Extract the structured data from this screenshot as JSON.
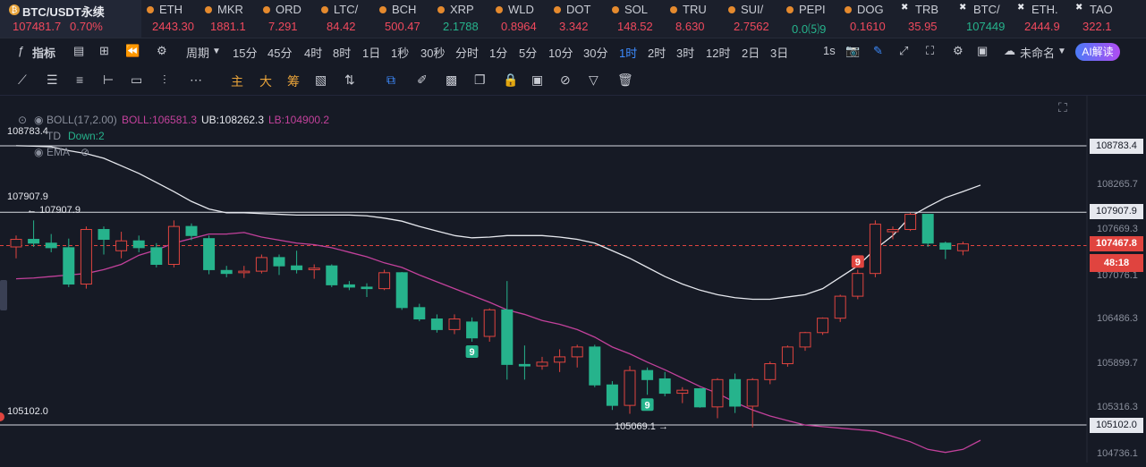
{
  "main_ticker": {
    "symbol": "BTC/USDT永续",
    "price": "107481.7",
    "change": "0.70%"
  },
  "tickers": [
    {
      "name": "ETH",
      "price": "2443.30",
      "color": "red",
      "x": 160
    },
    {
      "name": "MKR",
      "price": "1881.1",
      "color": "red",
      "x": 225
    },
    {
      "name": "ORD",
      "price": "7.291",
      "color": "red",
      "x": 290
    },
    {
      "name": "LTC/",
      "price": "84.42",
      "color": "red",
      "x": 355
    },
    {
      "name": "BCH",
      "price": "500.47",
      "color": "red",
      "x": 420
    },
    {
      "name": "XRP",
      "price": "2.1788",
      "color": "grn",
      "x": 485
    },
    {
      "name": "WLD",
      "price": "0.8964",
      "color": "red",
      "x": 550
    },
    {
      "name": "DOT",
      "price": "3.342",
      "color": "red",
      "x": 615
    },
    {
      "name": "SOL",
      "price": "148.52",
      "color": "red",
      "x": 680
    },
    {
      "name": "TRU",
      "price": "8.630",
      "color": "red",
      "x": 745
    },
    {
      "name": "SUI/",
      "price": "2.7562",
      "color": "red",
      "x": 810
    },
    {
      "name": "PEPI",
      "price": "0.0⑸9",
      "color": "grn",
      "x": 875
    },
    {
      "name": "DOG",
      "price": "0.1610",
      "color": "red",
      "x": 940
    },
    {
      "name": "TRB",
      "price": "35.95",
      "color": "red",
      "x": 1005,
      "x_icon": true
    },
    {
      "name": "BTC/",
      "price": "107449",
      "color": "grn",
      "x": 1070,
      "x_icon": true
    },
    {
      "name": "ETH.",
      "price": "2444.9",
      "color": "red",
      "x": 1135,
      "x_icon": true
    },
    {
      "name": "TAO",
      "price": "322.1",
      "color": "red",
      "x": 1200,
      "x_icon": true
    }
  ],
  "toolbar": {
    "indicators": "指标",
    "period": "周期",
    "intervals": [
      "15分",
      "45分",
      "4时",
      "8时",
      "1日",
      "1秒",
      "30秒",
      "分时",
      "1分",
      "5分",
      "10分",
      "30分",
      "1时",
      "2时",
      "3时",
      "12时",
      "2日",
      "3日"
    ],
    "active_interval": "1时",
    "seconds": "1s",
    "unnamed": "未命名",
    "ai": "AI解读"
  },
  "drawing_labels": {
    "zhu": "主",
    "da": "大",
    "chou": "筹"
  },
  "indicators": {
    "boll": "BOLL(17,2.00)",
    "boll_mid": "BOLL:106581.3",
    "ub": "UB:108262.3",
    "lb": "LB:104900.2",
    "td": "TD",
    "down": "Down:2",
    "ema": "EMA"
  },
  "annotations": {
    "left_top": "108783.4",
    "high": "107907.9",
    "high_mark": "107907.9",
    "low_left": "105102.0",
    "low_mark": "105069.1"
  },
  "price_axis": {
    "labels": [
      "108265.7",
      "107669.3",
      "107076.1",
      "106486.3",
      "105899.7",
      "105316.3",
      "104736.1"
    ],
    "boxes": [
      "108783.4",
      "107907.9",
      "105102.0"
    ],
    "current": "107467.8",
    "countdown": "48:18"
  },
  "chart_data": {
    "type": "candlestick",
    "colors": {
      "up": "#e0443f",
      "down": "#26b38c",
      "ub": "#e6e8ee",
      "lb": "#c2419b"
    },
    "ylim": [
      104700,
      109000
    ],
    "candles": [
      {
        "o": 107450,
        "h": 107600,
        "l": 107300,
        "c": 107550
      },
      {
        "o": 107550,
        "h": 107800,
        "l": 107450,
        "c": 107500
      },
      {
        "o": 107500,
        "h": 107620,
        "l": 107380,
        "c": 107440
      },
      {
        "o": 107440,
        "h": 107560,
        "l": 106920,
        "c": 106960
      },
      {
        "o": 106960,
        "h": 107720,
        "l": 106900,
        "c": 107680
      },
      {
        "o": 107680,
        "h": 107720,
        "l": 107350,
        "c": 107550
      },
      {
        "o": 107400,
        "h": 107650,
        "l": 107300,
        "c": 107530
      },
      {
        "o": 107530,
        "h": 107600,
        "l": 107380,
        "c": 107440
      },
      {
        "o": 107440,
        "h": 107500,
        "l": 107180,
        "c": 107220
      },
      {
        "o": 107220,
        "h": 107800,
        "l": 107180,
        "c": 107720
      },
      {
        "o": 107720,
        "h": 107760,
        "l": 107540,
        "c": 107600
      },
      {
        "o": 107560,
        "h": 107600,
        "l": 107090,
        "c": 107150
      },
      {
        "o": 107140,
        "h": 107200,
        "l": 107050,
        "c": 107100
      },
      {
        "o": 107110,
        "h": 107200,
        "l": 107040,
        "c": 107130
      },
      {
        "o": 107130,
        "h": 107350,
        "l": 107100,
        "c": 107310
      },
      {
        "o": 107310,
        "h": 107350,
        "l": 107080,
        "c": 107200
      },
      {
        "o": 107200,
        "h": 107400,
        "l": 107100,
        "c": 107150
      },
      {
        "o": 107150,
        "h": 107220,
        "l": 107030,
        "c": 107170
      },
      {
        "o": 107200,
        "h": 107220,
        "l": 106920,
        "c": 106950
      },
      {
        "o": 106950,
        "h": 107000,
        "l": 106880,
        "c": 106920
      },
      {
        "o": 106920,
        "h": 106970,
        "l": 106790,
        "c": 106900
      },
      {
        "o": 106900,
        "h": 107150,
        "l": 106880,
        "c": 107110
      },
      {
        "o": 107110,
        "h": 107120,
        "l": 106620,
        "c": 106650
      },
      {
        "o": 106650,
        "h": 106700,
        "l": 106470,
        "c": 106500
      },
      {
        "o": 106500,
        "h": 106560,
        "l": 106320,
        "c": 106360
      },
      {
        "o": 106360,
        "h": 106560,
        "l": 106300,
        "c": 106500
      },
      {
        "o": 106460,
        "h": 106520,
        "l": 106200,
        "c": 106250
      },
      {
        "o": 106270,
        "h": 106640,
        "l": 106200,
        "c": 106620
      },
      {
        "o": 106620,
        "h": 107000,
        "l": 105700,
        "c": 105900
      },
      {
        "o": 105900,
        "h": 106150,
        "l": 105700,
        "c": 105880
      },
      {
        "o": 105880,
        "h": 106000,
        "l": 105830,
        "c": 105930
      },
      {
        "o": 105930,
        "h": 106100,
        "l": 105800,
        "c": 106000
      },
      {
        "o": 106000,
        "h": 106160,
        "l": 105860,
        "c": 106130
      },
      {
        "o": 106130,
        "h": 106160,
        "l": 105600,
        "c": 105630
      },
      {
        "o": 105630,
        "h": 105680,
        "l": 105300,
        "c": 105360
      },
      {
        "o": 105360,
        "h": 105880,
        "l": 105250,
        "c": 105820
      },
      {
        "o": 105820,
        "h": 105860,
        "l": 105500,
        "c": 105700
      },
      {
        "o": 105710,
        "h": 105800,
        "l": 105480,
        "c": 105520
      },
      {
        "o": 105520,
        "h": 105600,
        "l": 105390,
        "c": 105560
      },
      {
        "o": 105580,
        "h": 105590,
        "l": 105330,
        "c": 105340
      },
      {
        "o": 105340,
        "h": 105720,
        "l": 105190,
        "c": 105700
      },
      {
        "o": 105700,
        "h": 105780,
        "l": 105260,
        "c": 105350
      },
      {
        "o": 105350,
        "h": 105720,
        "l": 105070,
        "c": 105700
      },
      {
        "o": 105700,
        "h": 105940,
        "l": 105640,
        "c": 105910
      },
      {
        "o": 105910,
        "h": 106150,
        "l": 105870,
        "c": 106130
      },
      {
        "o": 106130,
        "h": 106330,
        "l": 106080,
        "c": 106320
      },
      {
        "o": 106320,
        "h": 106520,
        "l": 106290,
        "c": 106510
      },
      {
        "o": 106510,
        "h": 106820,
        "l": 106460,
        "c": 106800
      },
      {
        "o": 106800,
        "h": 107150,
        "l": 106760,
        "c": 107100
      },
      {
        "o": 107100,
        "h": 107800,
        "l": 107050,
        "c": 107750
      },
      {
        "o": 107650,
        "h": 107720,
        "l": 107550,
        "c": 107680
      },
      {
        "o": 107680,
        "h": 107900,
        "l": 107660,
        "c": 107880
      },
      {
        "o": 107880,
        "h": 107880,
        "l": 107450,
        "c": 107500
      },
      {
        "o": 107500,
        "h": 107520,
        "l": 107290,
        "c": 107420
      },
      {
        "o": 107400,
        "h": 107520,
        "l": 107340,
        "c": 107490
      }
    ],
    "ub_line": [
      108785,
      108780,
      108770,
      108720,
      108680,
      108620,
      108520,
      108420,
      108300,
      108180,
      108050,
      107950,
      107900,
      107900,
      107890,
      107880,
      107870,
      107870,
      107870,
      107870,
      107860,
      107830,
      107790,
      107720,
      107660,
      107600,
      107570,
      107580,
      107600,
      107600,
      107600,
      107580,
      107550,
      107500,
      107400,
      107300,
      107180,
      107060,
      106960,
      106880,
      106820,
      106780,
      106760,
      106760,
      106790,
      106820,
      106900,
      107050,
      107200,
      107420,
      107600,
      107850,
      107980,
      108100,
      108180,
      108265
    ],
    "lb_line": [
      107030,
      107040,
      107060,
      107080,
      107100,
      107150,
      107220,
      107340,
      107410,
      107500,
      107560,
      107620,
      107620,
      107640,
      107580,
      107540,
      107500,
      107480,
      107440,
      107380,
      107320,
      107240,
      107180,
      107080,
      106990,
      106900,
      106810,
      106720,
      106620,
      106560,
      106480,
      106430,
      106360,
      106260,
      106130,
      106040,
      105930,
      105830,
      105720,
      105610,
      105520,
      105400,
      105300,
      105220,
      105160,
      105100,
      105080,
      105060,
      105040,
      105020,
      104950,
      104880,
      104780,
      104740,
      104780,
      104900
    ]
  },
  "marks": [
    {
      "label": "9",
      "idx": 26,
      "type": "down"
    },
    {
      "label": "9",
      "idx": 36,
      "type": "down"
    },
    {
      "label": "9",
      "idx": 48,
      "type": "up"
    }
  ]
}
